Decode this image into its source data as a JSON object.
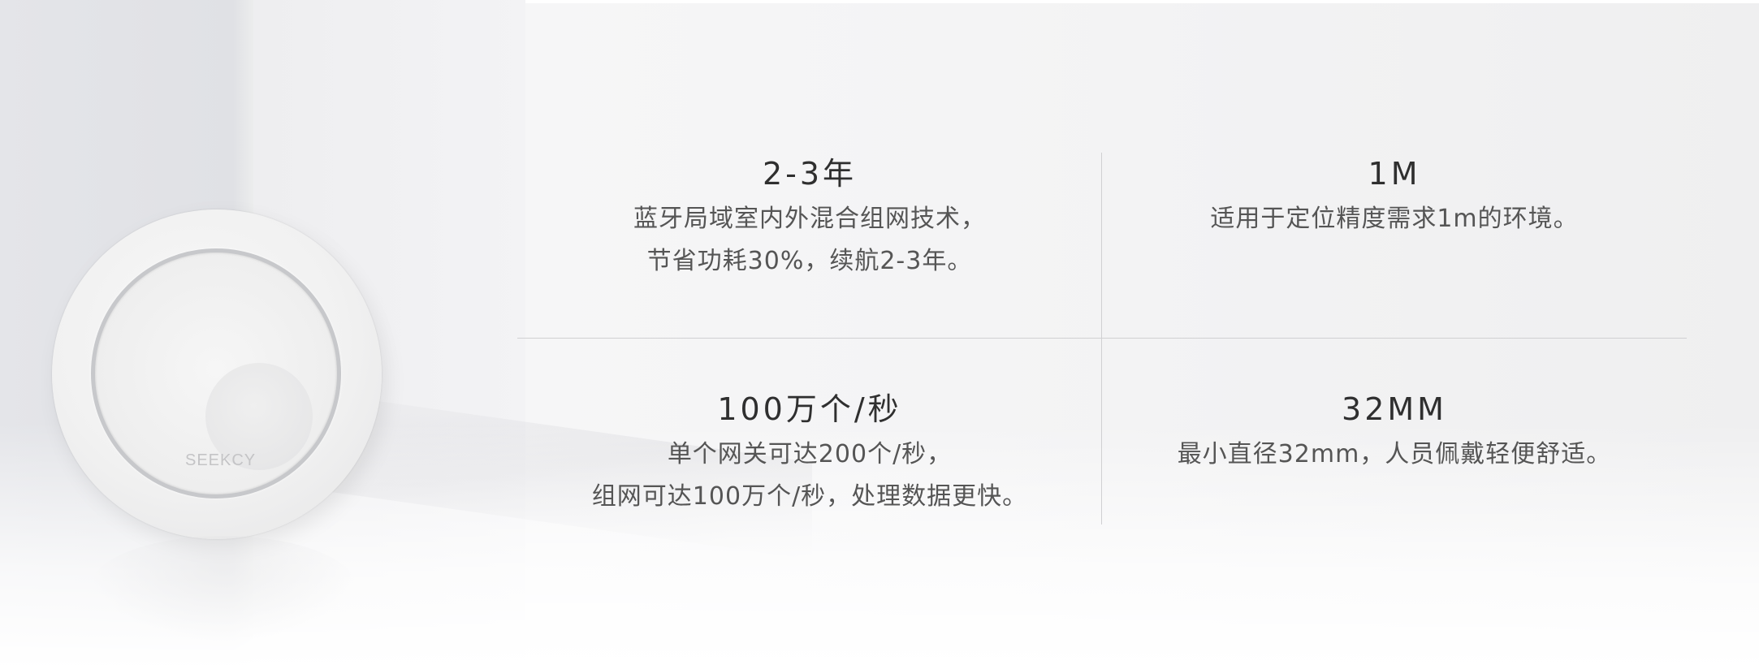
{
  "device": {
    "logo_text": "SEEKCY"
  },
  "features": [
    {
      "title": "2-3年",
      "desc_lines": [
        "蓝牙局域室内外混合组网技术，",
        "节省功耗30%，续航2-3年。"
      ]
    },
    {
      "title": "1M",
      "desc_lines": [
        "适用于定位精度需求1m的环境。"
      ]
    },
    {
      "title": "100万个/秒",
      "desc_lines": [
        "单个网关可达200个/秒，",
        "组网可达100万个/秒，处理数据更快。"
      ]
    },
    {
      "title": "32MM",
      "desc_lines": [
        "最小直径32mm，人员佩戴轻便舒适。"
      ]
    }
  ]
}
